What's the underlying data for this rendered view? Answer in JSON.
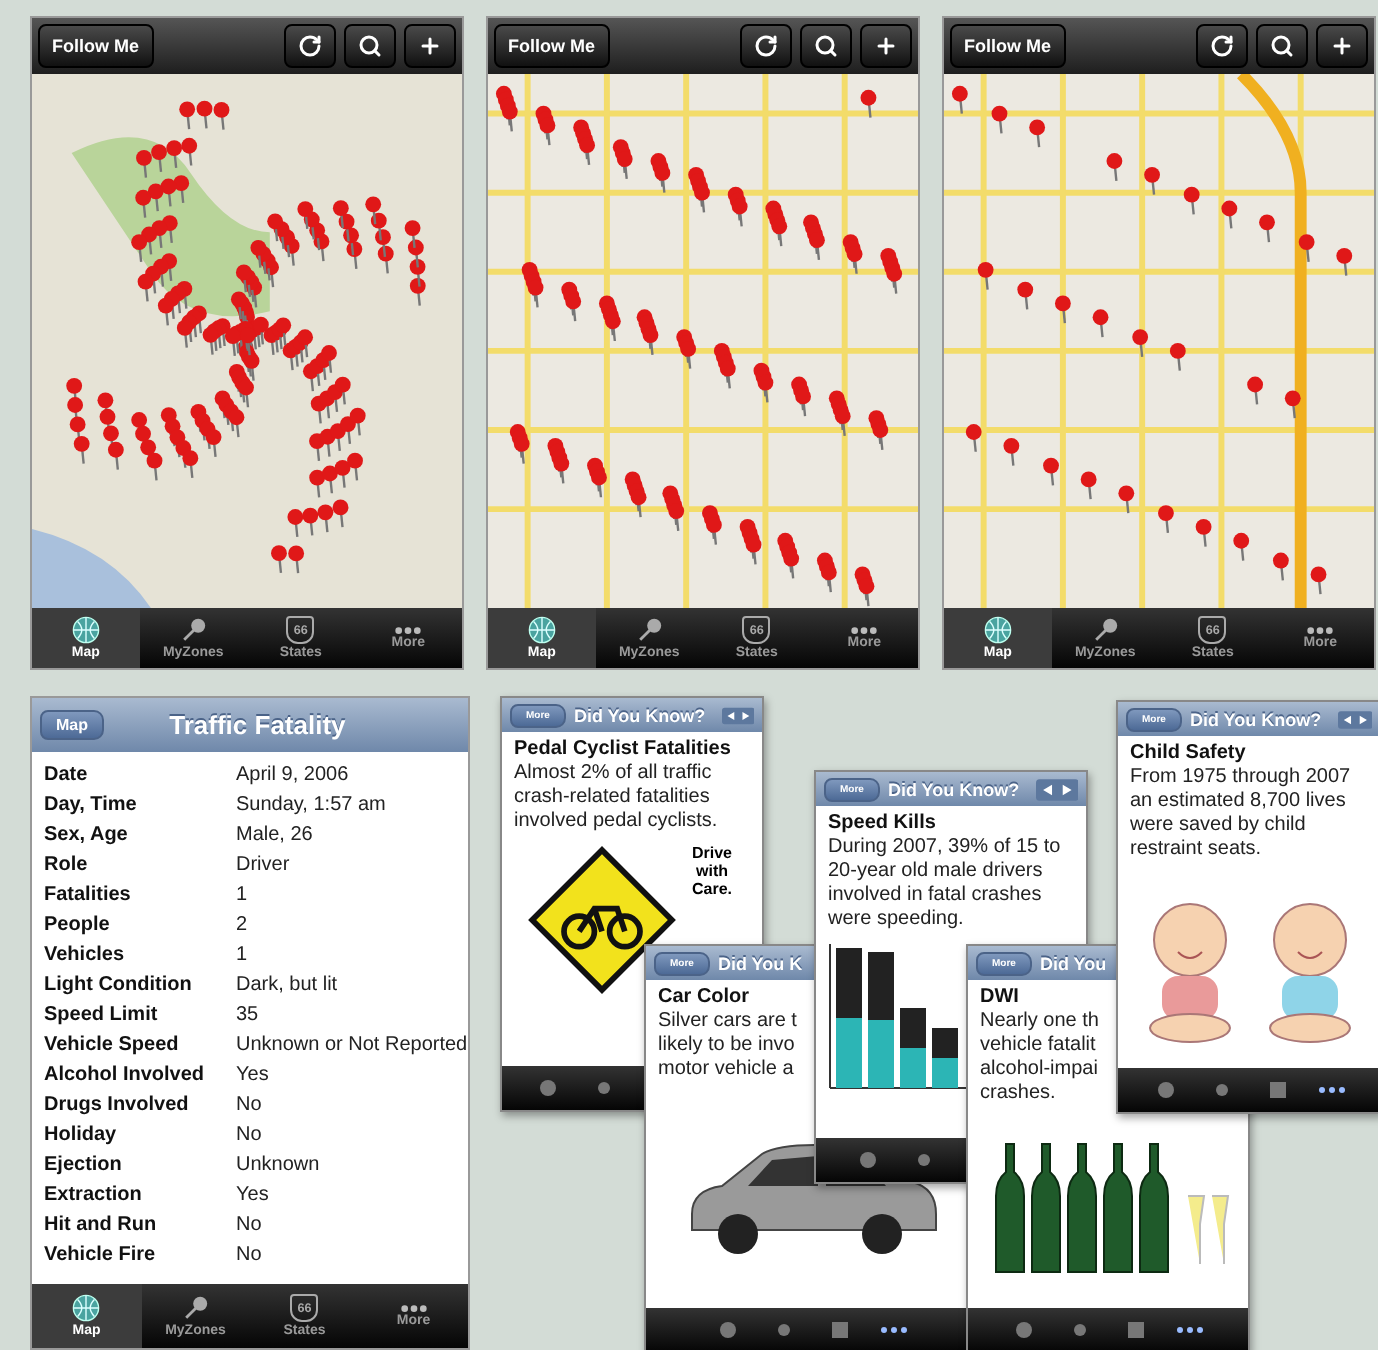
{
  "maps": [
    {
      "follow_button": "Follow Me",
      "tabs": [
        {
          "label": "Map",
          "kind": "globe",
          "selected": true
        },
        {
          "label": "MyZones",
          "kind": "pin",
          "selected": false
        },
        {
          "label": "States",
          "kind": "shield",
          "badge": "66",
          "selected": false
        },
        {
          "label": "More",
          "kind": "dots",
          "selected": false
        }
      ]
    },
    {
      "follow_button": "Follow Me",
      "tabs": [
        {
          "label": "Map",
          "kind": "globe",
          "selected": true
        },
        {
          "label": "MyZones",
          "kind": "pin",
          "selected": false
        },
        {
          "label": "States",
          "kind": "shield",
          "badge": "66",
          "selected": false
        },
        {
          "label": "More",
          "kind": "dots",
          "selected": false
        }
      ]
    },
    {
      "follow_button": "Follow Me",
      "tabs": [
        {
          "label": "Map",
          "kind": "globe",
          "selected": true
        },
        {
          "label": "MyZones",
          "kind": "pin",
          "selected": false
        },
        {
          "label": "States",
          "kind": "shield",
          "badge": "66",
          "selected": false
        },
        {
          "label": "More",
          "kind": "dots",
          "selected": false
        }
      ]
    }
  ],
  "detail": {
    "back_button": "Map",
    "title": "Traffic Fatality",
    "rows": [
      {
        "label": "Date",
        "value": "April 9, 2006"
      },
      {
        "label": "Day, Time",
        "value": "Sunday, 1:57 am"
      },
      {
        "label": "Sex, Age",
        "value": "Male, 26"
      },
      {
        "label": "Role",
        "value": "Driver"
      },
      {
        "label": "Fatalities",
        "value": "1"
      },
      {
        "label": "People",
        "value": "2"
      },
      {
        "label": "Vehicles",
        "value": "1"
      },
      {
        "label": "Light Condition",
        "value": "Dark, but lit"
      },
      {
        "label": "Speed Limit",
        "value": "35"
      },
      {
        "label": "Vehicle Speed",
        "value": "Unknown or Not Reported"
      },
      {
        "label": "Alcohol Involved",
        "value": "Yes"
      },
      {
        "label": "Drugs Involved",
        "value": "No"
      },
      {
        "label": "Holiday",
        "value": "No"
      },
      {
        "label": "Ejection",
        "value": "Unknown"
      },
      {
        "label": "Extraction",
        "value": "Yes"
      },
      {
        "label": "Hit and Run",
        "value": "No"
      },
      {
        "label": "Vehicle Fire",
        "value": "No"
      }
    ],
    "tabs": [
      {
        "label": "Map",
        "kind": "globe",
        "selected": true
      },
      {
        "label": "MyZones",
        "kind": "pin",
        "selected": false
      },
      {
        "label": "States",
        "kind": "shield",
        "badge": "66",
        "selected": false
      },
      {
        "label": "More",
        "kind": "dots",
        "selected": false
      }
    ]
  },
  "cards": [
    {
      "kind": "sign",
      "back_button": "More",
      "title": "Did You Know?",
      "arrows": true,
      "heading": "Pedal Cyclist Fatalities",
      "lines": [
        "Almost 2% of all traffic",
        "crash-related fatalities",
        "involved pedal cyclists."
      ],
      "sign_text": "Drive with Care."
    },
    {
      "kind": "car",
      "back_button": "More",
      "title": "Did You K",
      "heading": "Car Color",
      "lines": [
        "Silver cars are t",
        "likely to be invo",
        "motor vehicle a"
      ]
    },
    {
      "kind": "chart",
      "back_button": "More",
      "title": "Did You Know?",
      "arrows": true,
      "heading": "Speed Kills",
      "lines": [
        "During 2007, 39% of 15 to",
        "20-year old male drivers",
        "involved in fatal crashes",
        "were speeding."
      ]
    },
    {
      "kind": "bottles",
      "back_button": "More",
      "title": "Did You",
      "heading": "DWI",
      "lines": [
        "Nearly one th",
        "vehicle fatalit",
        "alcohol-impai",
        "crashes."
      ]
    },
    {
      "kind": "babies",
      "back_button": "More",
      "title": "Did You Know?",
      "arrows": true,
      "heading": "Child Safety",
      "lines": [
        "From 1975 through 2007",
        "an estimated 8,700 lives",
        "were saved by child",
        "restraint seats."
      ]
    }
  ]
}
